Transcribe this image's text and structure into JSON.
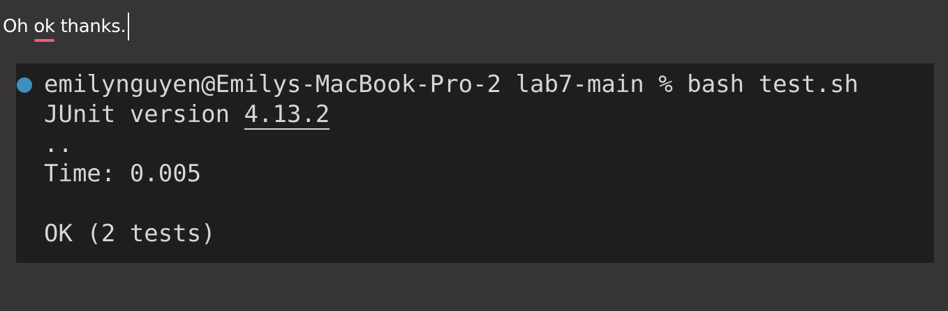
{
  "message": {
    "text_before": "Oh ",
    "misspelled_word": "ok",
    "text_after": " thanks.",
    "spellcheck_color": "#ec5f7b"
  },
  "terminal": {
    "status_dot_color": "#3f8fbf",
    "prompt_line": "emilynguyen@Emilys-MacBook-Pro-2 lab7-main % bash test.sh",
    "junit_prefix": "JUnit version ",
    "junit_version": "4.13.2",
    "progress_dots": "..",
    "time_line": "Time: 0.005",
    "result_line": "OK (2 tests)"
  }
}
